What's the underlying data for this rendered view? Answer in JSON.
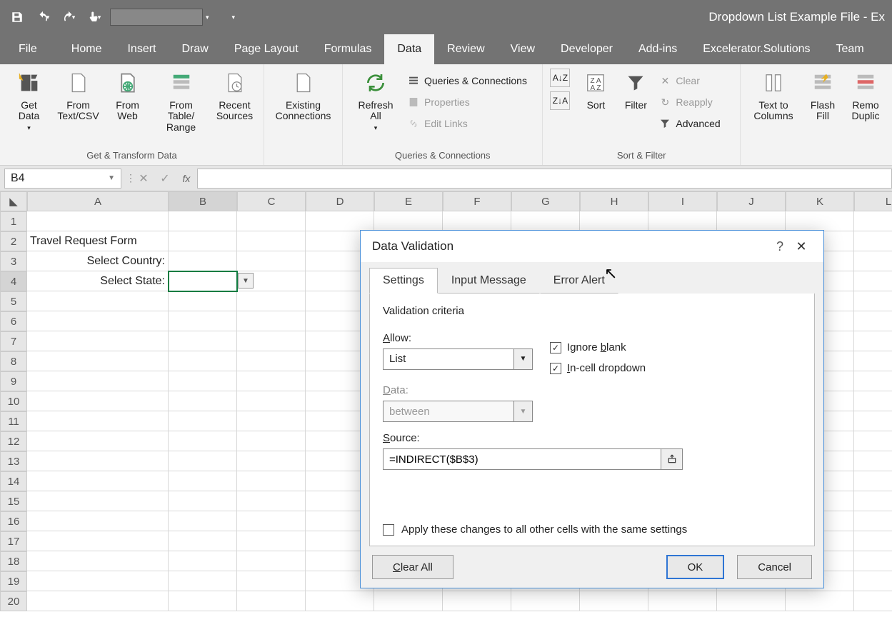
{
  "title": "Dropdown List Example File  -  Ex",
  "ribbon_tabs": {
    "file": "File",
    "home": "Home",
    "insert": "Insert",
    "draw": "Draw",
    "page_layout": "Page Layout",
    "formulas": "Formulas",
    "data": "Data",
    "review": "Review",
    "view": "View",
    "developer": "Developer",
    "addins": "Add-ins",
    "excelerator": "Excelerator.Solutions",
    "team": "Team"
  },
  "ribbon": {
    "group1_label": "Get & Transform Data",
    "get_data": "Get\nData",
    "from_textcsv": "From\nText/CSV",
    "from_web": "From\nWeb",
    "from_table": "From Table/\nRange",
    "recent": "Recent\nSources",
    "existing": "Existing\nConnections",
    "group2_label": "Queries & Connections",
    "refresh_all": "Refresh\nAll",
    "queries": "Queries & Connections",
    "properties": "Properties",
    "edit_links": "Edit Links",
    "group3_label": "Sort & Filter",
    "sort": "Sort",
    "filter": "Filter",
    "clear": "Clear",
    "reapply": "Reapply",
    "advanced": "Advanced",
    "text_to_cols": "Text to\nColumns",
    "flash_fill": "Flash\nFill",
    "remove_dup": "Remo\nDuplic"
  },
  "namebox": "B4",
  "columns": [
    "A",
    "B",
    "C",
    "D",
    "E",
    "F",
    "G",
    "H",
    "I",
    "J",
    "K",
    "L"
  ],
  "rows": [
    "1",
    "2",
    "3",
    "4",
    "5",
    "6",
    "7",
    "8",
    "9",
    "10",
    "11",
    "12",
    "13",
    "14",
    "15",
    "16",
    "17",
    "18",
    "19",
    "20"
  ],
  "cells": {
    "A2": "Travel Request Form",
    "A3": "Select Country:",
    "A4": "Select State:"
  },
  "dialog": {
    "title": "Data Validation",
    "tabs": {
      "settings": "Settings",
      "input_msg": "Input Message",
      "error": "Error Alert"
    },
    "criteria_title": "Validation criteria",
    "allow_label": "Allow:",
    "allow_value": "List",
    "ignore_blank": "Ignore blank",
    "incell": "In-cell dropdown",
    "data_label": "Data:",
    "data_value": "between",
    "source_label": "Source:",
    "source_value": "=INDIRECT($B$3)",
    "apply_all": "Apply these changes to all other cells with the same settings",
    "clear_all": "Clear All",
    "ok": "OK",
    "cancel": "Cancel"
  }
}
